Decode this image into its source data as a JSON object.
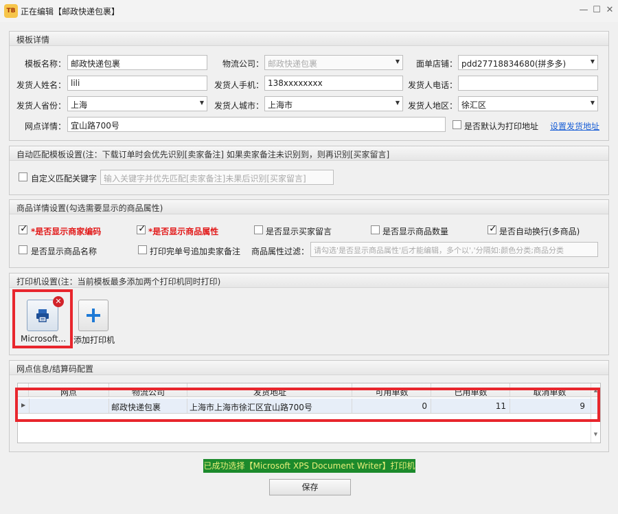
{
  "window": {
    "title": "正在编辑【邮政快递包裹】",
    "logo_text": "TB",
    "min_icon": "minimize-icon",
    "max_icon": "maximize-icon",
    "close_icon": "close-icon"
  },
  "template": {
    "header": "模板详情",
    "name_label": "模板名称：",
    "name_value": "邮政快递包裹",
    "logistics_label": "物流公司：",
    "logistics_value": "邮政快递包裹",
    "shop_label": "面单店铺：",
    "shop_value": "pdd27718834680(拼多多)",
    "sender_name_label": "发货人姓名：",
    "sender_name_value": "lili",
    "sender_mobile_label": "发货人手机：",
    "sender_mobile_value": "138xxxxxxxx",
    "sender_phone_label": "发货人电话：",
    "sender_phone_value": "",
    "province_label": "发货人省份：",
    "province_value": "上海",
    "city_label": "发货人城市：",
    "city_value": "上海市",
    "district_label": "发货人地区：",
    "district_value": "徐汇区",
    "outlet_label": "网点详情：",
    "outlet_value": "宜山路700号",
    "default_label": "是否默认为打印地址",
    "set_address_link": "设置发货地址"
  },
  "auto_match": {
    "header": "自动匹配模板设置(注：下载订单时会优先识别[卖家备注] 如果卖家备注未识别到，则再识别[买家留言]",
    "custom_label": "自定义匹配关键字",
    "keyword_placeholder": "输入关键字并优先匹配[卖家备注]未果后识别[买家留言]"
  },
  "product": {
    "header": "商品详情设置(勾选需要显示的商品属性)",
    "opt_seller_code": "*是否显示商家编码",
    "opt_attr": "*是否显示商品属性",
    "opt_buyer_msg": "是否显示买家留言",
    "opt_qty": "是否显示商品数量",
    "opt_wrap": "是否自动换行(多商品)",
    "opt_name": "是否显示商品名称",
    "opt_append_note": "打印完单号追加卖家备注",
    "filter_label": "商品属性过滤：",
    "filter_placeholder": "请勾选'是否显示商品属性'后才能编辑，多个以','分隔如:颜色分类;商品分类"
  },
  "printer": {
    "header": "打印机设置(注：当前模板最多添加两个打印机同时打印)",
    "printer_name": "Microsoft...",
    "add_label": "添加打印机"
  },
  "outlet_grid": {
    "header": "网点信息/结算码配置",
    "columns": [
      "网点",
      "物流公司",
      "发货地址",
      "可用单数",
      "已用单数",
      "取消单数"
    ],
    "rows": [
      {
        "outlet": "",
        "company": "邮政快递包裹",
        "address": "上海市上海市徐汇区宜山路700号",
        "available": "0",
        "used": "11",
        "cancelled": "9"
      }
    ]
  },
  "status_message": "已成功选择【Microsoft XPS Document Writer】打印机",
  "save_label": "保存",
  "colors": {
    "highlight": "#e8262d",
    "status_bg": "#1c8a2c",
    "status_fg": "#e8f07a",
    "link": "#1a5fd6"
  }
}
